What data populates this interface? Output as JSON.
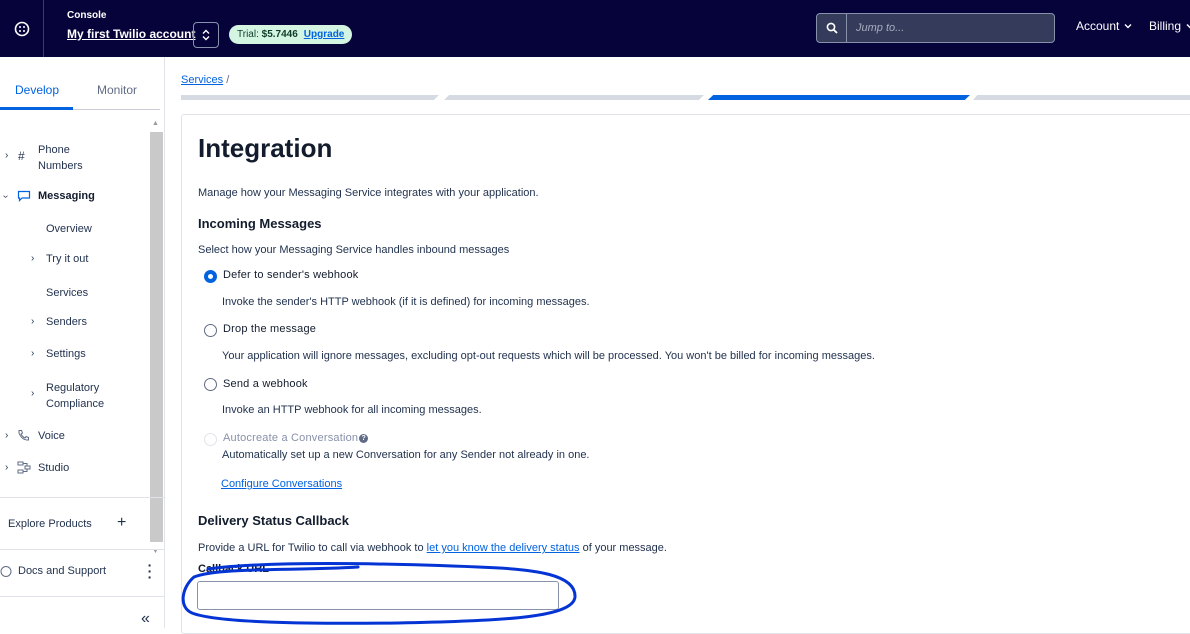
{
  "topbar": {
    "console_label": "Console",
    "account_name": "My first Twilio account",
    "trial_label": "Trial:",
    "trial_balance": "$5.7446",
    "upgrade_label": "Upgrade",
    "search_placeholder": "Jump to...",
    "account_menu": "Account",
    "billing_menu": "Billing",
    "colors": {
      "background": "#06033a",
      "badge_bg": "#d4f5e2",
      "link": "#0263e0"
    }
  },
  "sidebar": {
    "tabs": [
      {
        "label": "Develop",
        "active": true
      },
      {
        "label": "Monitor",
        "active": false
      }
    ],
    "items": [
      {
        "label": "Phone Numbers",
        "icon": "hash-icon",
        "expanded": false
      },
      {
        "label": "Messaging",
        "icon": "chat-bubble-icon",
        "expanded": true
      },
      {
        "label": "Overview"
      },
      {
        "label": "Try it out",
        "expandable": true
      },
      {
        "label": "Services"
      },
      {
        "label": "Senders",
        "expandable": true
      },
      {
        "label": "Settings",
        "expandable": true
      },
      {
        "label": "Regulatory Compliance",
        "expandable": true
      },
      {
        "label": "Voice",
        "icon": "phone-icon",
        "expanded": false
      },
      {
        "label": "Studio",
        "icon": "flow-icon",
        "expanded": false
      }
    ],
    "explore_products": "Explore Products",
    "docs_and_support": "Docs and Support"
  },
  "breadcrumb": {
    "services": "Services",
    "separator": "/"
  },
  "main": {
    "title": "Integration",
    "description": "Manage how your Messaging Service integrates with your application.",
    "incoming": {
      "heading": "Incoming Messages",
      "subtext": "Select how your Messaging Service handles inbound messages",
      "options": [
        {
          "label": "Defer to sender's webhook",
          "help": "Invoke the sender's HTTP webhook (if it is defined) for incoming messages.",
          "checked": true
        },
        {
          "label": "Drop the message",
          "help": "Your application will ignore messages, excluding opt-out requests which will be processed. You won't be billed for incoming messages.",
          "checked": false
        },
        {
          "label": "Send a webhook",
          "help": "Invoke an HTTP webhook for all incoming messages.",
          "checked": false
        },
        {
          "label": "Autocreate a Conversation",
          "help": "Automatically set up a new Conversation for any Sender not already in one.",
          "checked": false,
          "disabled": true
        }
      ],
      "configure_link": "Configure Conversations"
    },
    "delivery": {
      "heading": "Delivery Status Callback",
      "text_before": "Provide a URL for Twilio to call via webhook to",
      "link": "let you know the delivery status",
      "text_after": "of your message.",
      "field_label": "Callback URL",
      "field_value": ""
    }
  }
}
